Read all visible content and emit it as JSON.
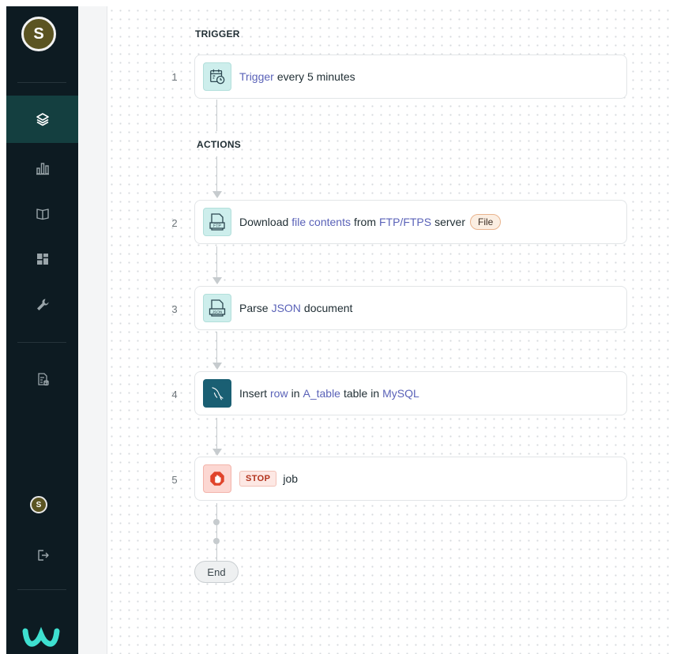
{
  "sidebar": {
    "avatar_initial": "S",
    "small_avatar_initial": "S",
    "items": [
      {
        "icon": "layers-icon",
        "active": true
      },
      {
        "icon": "bar-chart-icon"
      },
      {
        "icon": "book-icon"
      },
      {
        "icon": "dashboard-grid-icon"
      },
      {
        "icon": "wrench-icon"
      },
      {
        "icon": "file-database-icon"
      },
      {
        "icon": "logout-icon"
      }
    ],
    "logo_icon": "workato-logo-icon"
  },
  "recipe": {
    "trigger_label": "TRIGGER",
    "actions_label": "ACTIONS",
    "end_label": "End",
    "steps": [
      {
        "num": "1",
        "icon": "calendar-clock-icon",
        "parts": [
          "Trigger",
          "every 5 minutes"
        ]
      },
      {
        "num": "2",
        "icon": "ftp-file-icon",
        "icon_text": "FTP",
        "parts": [
          "Download",
          "file contents",
          "from",
          "FTP/FTPS",
          "server"
        ],
        "pill": "File"
      },
      {
        "num": "3",
        "icon": "json-file-icon",
        "icon_text": "JSON",
        "parts": [
          "Parse",
          "JSON",
          "document"
        ]
      },
      {
        "num": "4",
        "icon": "mysql-icon",
        "parts": [
          "Insert",
          "row",
          "in",
          "A_table",
          "table in",
          "MySQL"
        ]
      },
      {
        "num": "5",
        "icon": "stop-hand-icon",
        "badge": "STOP",
        "parts": [
          "job"
        ]
      }
    ]
  },
  "colors": {
    "sidebar_bg": "#0d1b22",
    "active_item_bg": "#143f40",
    "link": "#5a62b8",
    "teal_icon_bg": "#cdeeec",
    "mysql_bg": "#1a5f73",
    "stop_red": "#b2321c",
    "logo": "#3ee0d0"
  }
}
